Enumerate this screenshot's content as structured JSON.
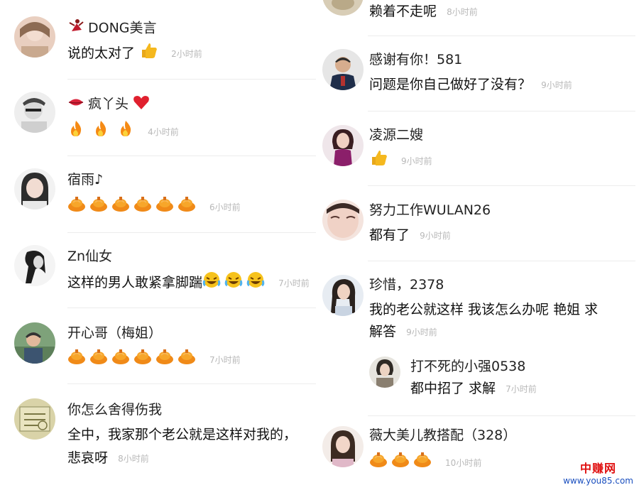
{
  "left": [
    {
      "name": "DONG美言",
      "prefix_icon": "dancer-icon",
      "text": "说的太对了",
      "emojis": [
        "thumbs-up-icon"
      ],
      "time": "2小时前"
    },
    {
      "name": "疯丫头",
      "prefix_icon": "lips-icon",
      "suffix_icon": "heart-icon",
      "text": "",
      "emojis": [
        "fire-icon",
        "fire-icon",
        "fire-icon"
      ],
      "time": "4小时前"
    },
    {
      "name": "宿雨♪",
      "text": "",
      "emojis": [
        "cake-icon",
        "cake-icon",
        "cake-icon",
        "cake-icon",
        "cake-icon",
        "cake-icon"
      ],
      "time": "6小时前"
    },
    {
      "name": "Zn仙女",
      "text": "这样的男人敢紧拿脚踹",
      "emojis": [
        "laugh-icon",
        "laugh-icon",
        "laugh-icon"
      ],
      "time": "7小时前"
    },
    {
      "name": "开心哥（梅姐）",
      "text": "",
      "emojis": [
        "cake-icon",
        "cake-icon",
        "cake-icon",
        "cake-icon",
        "cake-icon",
        "cake-icon"
      ],
      "time": "7小时前"
    },
    {
      "name": "你怎么舍得伤我",
      "text": "全中，我家那个老公就是这样对我的，",
      "text2": "悲哀呀",
      "time": "8小时前"
    }
  ],
  "right": [
    {
      "text": "赖着不走呢",
      "time": "8小时前"
    },
    {
      "name": "感谢有你！581",
      "text": "问题是你自己做好了没有？",
      "time": "9小时前"
    },
    {
      "name": "凌源二嫂",
      "text": "",
      "emojis": [
        "thumbs-up-icon"
      ],
      "time": "9小时前"
    },
    {
      "name": "努力工作WULAN26",
      "text": "都有了",
      "time": "9小时前"
    },
    {
      "name": "珍惜，2378",
      "text": "我的老公就这样 我该怎么办呢 艳姐 求",
      "text2": "解答",
      "time": "9小时前"
    },
    {
      "name": "打不死的小强0538",
      "text": "都中招了 求解",
      "time": "7小时前"
    },
    {
      "name": "薇大美儿教搭配（328）",
      "text": "",
      "emojis": [
        "cake-icon",
        "cake-icon",
        "cake-icon"
      ],
      "time": "10小时前"
    }
  ],
  "watermark": {
    "cn": "中赚网",
    "url": "www.you85.com"
  }
}
